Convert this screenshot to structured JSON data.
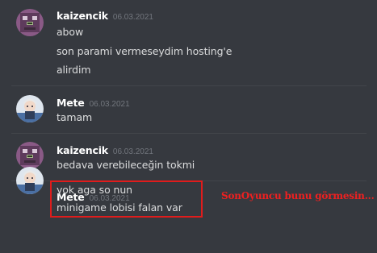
{
  "messages": [
    {
      "username": "kaizencik",
      "timestamp": "06.03.2021",
      "avatar_icon": "minecraft-face-avatar",
      "lines": [
        "abow",
        "son parami vermeseydim hosting'e",
        "alirdim"
      ]
    },
    {
      "username": "Mete",
      "timestamp": "06.03.2021",
      "avatar_icon": "anime-character-avatar",
      "lines": [
        "tamam"
      ]
    },
    {
      "username": "kaizencik",
      "timestamp": "06.03.2021",
      "avatar_icon": "minecraft-face-avatar",
      "lines": [
        "bedava verebileceğin tokmi"
      ]
    },
    {
      "username": "Mete",
      "timestamp": "06.03.2021",
      "avatar_icon": "anime-character-avatar",
      "lines": [
        "yok aga so nun",
        "minigame lobisi falan var"
      ]
    }
  ],
  "annotation": {
    "text": "SonOyuncu bunu görmesin...",
    "color": "#e01c1c"
  },
  "colors": {
    "background": "#36393f",
    "username": "#ffffff",
    "timestamp": "#72767d",
    "message_text": "#dcddde"
  }
}
